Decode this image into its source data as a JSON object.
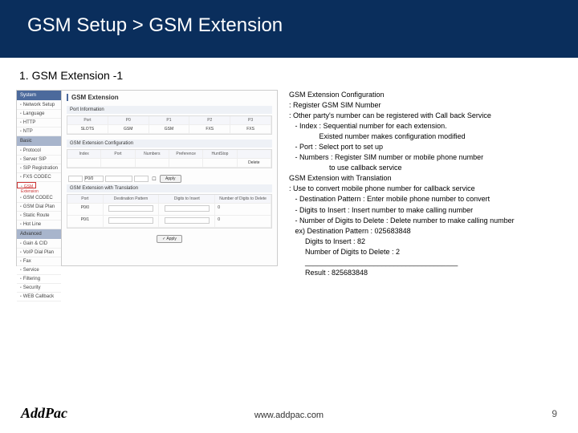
{
  "header": {
    "title": "GSM Setup > GSM Extension"
  },
  "subtitle": "1. GSM Extension -1",
  "shot": {
    "sidebar": {
      "system_header": "System",
      "system_items": [
        "Network Setup",
        "Language",
        "HTTP",
        "NTP"
      ],
      "basic_header": "Basic",
      "basic_items_pre": [
        "Protocol",
        "Server SIP",
        "SIP Registration",
        "FXS CODEC"
      ],
      "basic_selected": "GSM Extension",
      "basic_items_post": [
        "GSM CODEC",
        "GSM Dial Plan",
        "Static Route",
        "Hot Line"
      ],
      "advanced_header": "Advanced",
      "advanced_items": [
        "Gain & CID",
        "VoIP Dial Plan",
        "Fax",
        "Service",
        "Filtering",
        "Security",
        "WEB Callback"
      ]
    },
    "main": {
      "title": "GSM Extension",
      "port_info": "Port Information",
      "port_h": [
        "Port",
        "P0",
        "P1",
        "P2",
        "P3"
      ],
      "port_r": [
        "SLOTS",
        "GSM",
        "GSM",
        "FXS",
        "FXS"
      ],
      "ext_cfg": "GSM Extension Configuration",
      "ext_h": [
        "Index",
        "Port",
        "Numbers",
        "Preference",
        "HuntStop"
      ],
      "p00": "P0/0",
      "apply": "Apply",
      "delete": "Delete",
      "ext_trans": "GSM Extension with Translation",
      "trans_h": [
        "Port",
        "Destination Pattern",
        "Digits to Insert",
        "Number of Digits to Delete"
      ],
      "p0": "P0/0",
      "p1": "P0/1",
      "zero": "0",
      "apply2": "Apply"
    }
  },
  "text": {
    "l1": "GSM Extension Configuration",
    "l2": ": Register GSM SIM Number",
    "l3": ": Other party's number can be registered with Call back Service",
    "l4": "   - Index : Sequential number for each extension.",
    "l5": "               Existed number makes configuration modified",
    "l6": "   - Port : Select port to set up",
    "l7": "   - Numbers : Register SIM number or mobile phone number",
    "l8": "                    to use callback service",
    "l9": "",
    "l10": "GSM Extension with Translation",
    "l11": ": Use to convert mobile phone number for callback service",
    "l12": "   - Destination Pattern : Enter mobile phone number to convert",
    "l13": "   - Digits to Insert : Insert number to make calling number",
    "l14": "   - Number of Digits to Delete : Delete number to make calling number",
    "l15": "",
    "l16": "   ex) Destination Pattern : 025683848",
    "l17": "        Digits to Insert : 82",
    "l18": "        Number of Digits to Delete : 2",
    "l19": "        ______________________________________",
    "l20": "        Result : 825683848"
  },
  "footer": {
    "brand": "AddPac",
    "url": "www.addpac.com",
    "page": "9"
  }
}
